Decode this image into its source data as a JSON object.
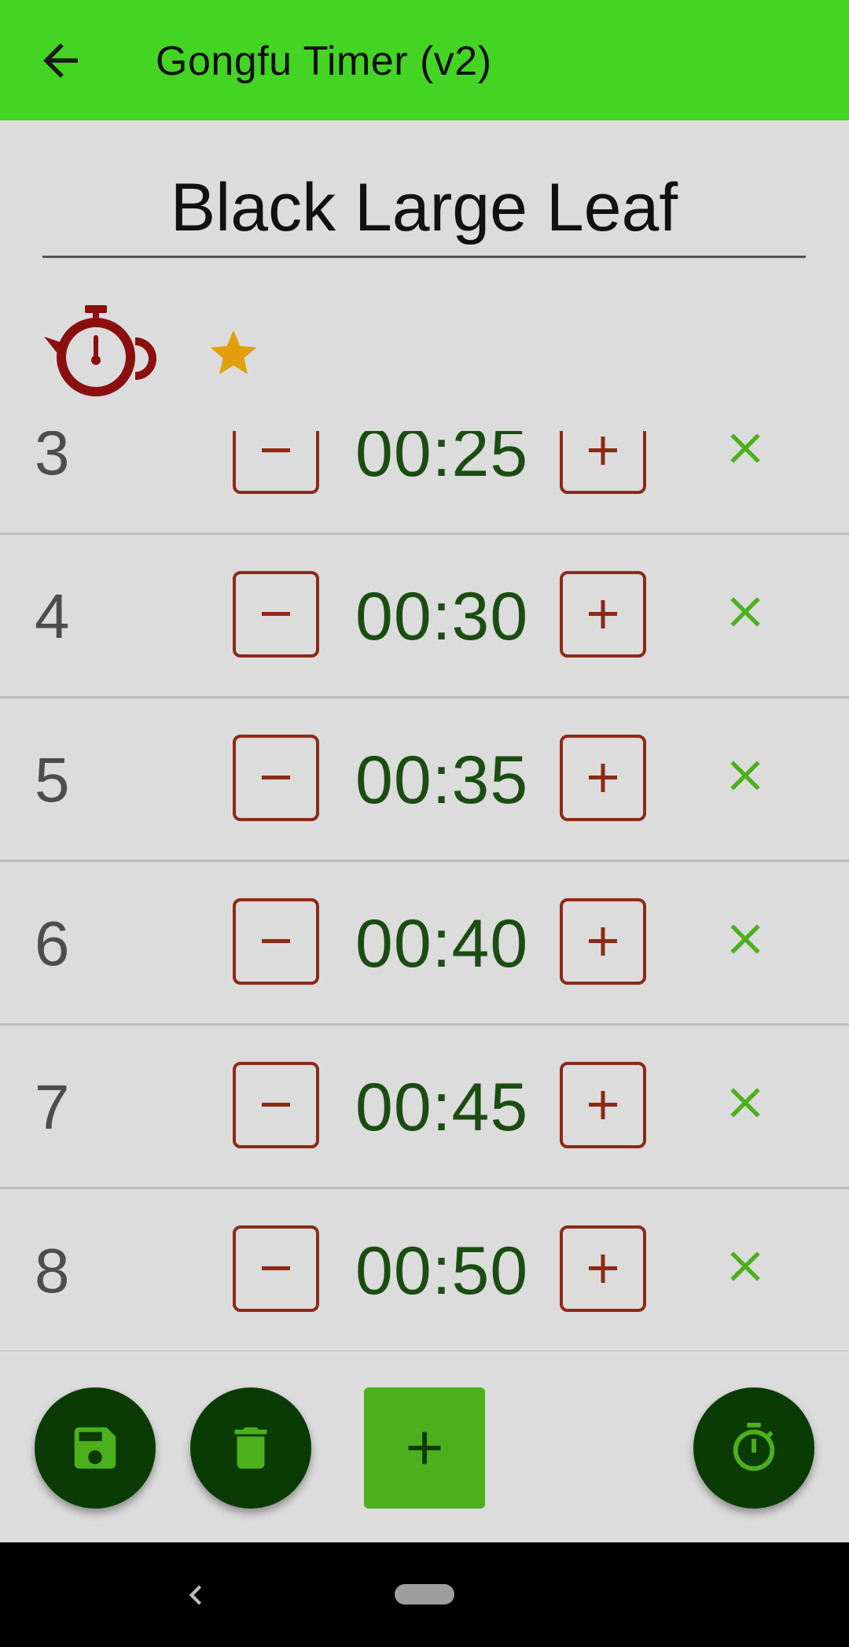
{
  "appbar": {
    "title": "Gongfu Timer (v2)"
  },
  "tea": {
    "name": "Black Large Leaf",
    "favorite": true
  },
  "colors": {
    "appbar": "#44d424",
    "time_text": "#1b4d12",
    "button_border": "#8c2a16",
    "delete_icon": "#4cb01c",
    "star": "#e39e0d",
    "teapot": "#8b0f0f",
    "fab": "#0a3b04",
    "add_button": "#4cb01c"
  },
  "infusions": [
    {
      "index": "3",
      "time": "00:25"
    },
    {
      "index": "4",
      "time": "00:30"
    },
    {
      "index": "5",
      "time": "00:35"
    },
    {
      "index": "6",
      "time": "00:40"
    },
    {
      "index": "7",
      "time": "00:45"
    },
    {
      "index": "8",
      "time": "00:50"
    }
  ],
  "icons": {
    "back": "arrow-left-icon",
    "teapot": "teapot-timer-icon",
    "favorite": "star-icon",
    "decrease": "minus-icon",
    "increase": "plus-icon",
    "delete": "close-icon",
    "save": "save-icon",
    "trash": "trash-icon",
    "add": "plus-icon",
    "timer": "stopwatch-icon",
    "nav_back": "chevron-left-icon",
    "nav_home": "home-pill"
  }
}
